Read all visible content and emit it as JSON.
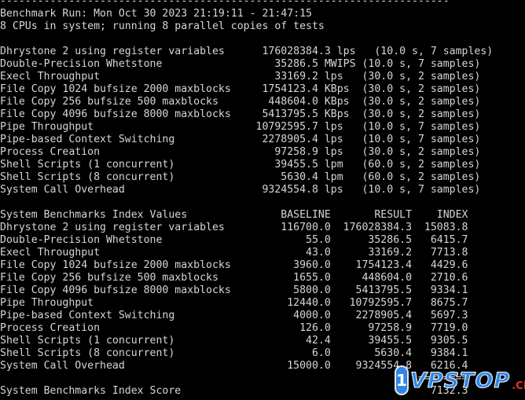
{
  "terminal": {
    "lines": [
      "------------------------------------------------------------------------",
      "Benchmark Run: Mon Oct 30 2023 21:19:11 - 21:47:15",
      "8 CPUs in system; running 8 parallel copies of tests",
      "",
      "Dhrystone 2 using register variables      176028384.3 lps   (10.0 s, 7 samples)",
      "Double-Precision Whetstone                  35286.5 MWIPS (10.0 s, 7 samples)",
      "Execl Throughput                            33169.2 lps   (30.0 s, 2 samples)",
      "File Copy 1024 bufsize 2000 maxblocks     1754123.4 KBps  (30.0 s, 2 samples)",
      "File Copy 256 bufsize 500 maxblocks        448604.0 KBps  (30.0 s, 2 samples)",
      "File Copy 4096 bufsize 8000 maxblocks     5413795.5 KBps  (30.0 s, 2 samples)",
      "Pipe Throughput                          10792595.7 lps   (10.0 s, 7 samples)",
      "Pipe-based Context Switching              2278905.4 lps   (10.0 s, 7 samples)",
      "Process Creation                            97258.9 lps   (30.0 s, 2 samples)",
      "Shell Scripts (1 concurrent)                39455.5 lpm   (60.0 s, 2 samples)",
      "Shell Scripts (8 concurrent)                 5630.4 lpm   (60.0 s, 2 samples)",
      "System Call Overhead                      9324554.8 lps   (10.0 s, 7 samples)",
      "",
      "System Benchmarks Index Values               BASELINE       RESULT    INDEX",
      "Dhrystone 2 using register variables         116700.0  176028384.3  15083.8",
      "Double-Precision Whetstone                       55.0      35286.5   6415.7",
      "Execl Throughput                                 43.0      33169.2   7713.8",
      "File Copy 1024 bufsize 2000 maxblocks          3960.0    1754123.4   4429.6",
      "File Copy 256 bufsize 500 maxblocks            1655.0     448604.0   2710.6",
      "File Copy 4096 bufsize 8000 maxblocks          5800.0    5413795.5   9334.1",
      "Pipe Throughput                               12440.0   10792595.7   8675.7",
      "Pipe-based Context Switching                   4000.0    2278905.4   5697.3",
      "Process Creation                                126.0      97258.9   7719.0",
      "Shell Scripts (1 concurrent)                     42.4      39455.5   9305.5",
      "Shell Scripts (8 concurrent)                      6.0       5630.4   9384.1",
      "System Call Overhead                          15000.0    9324554.8   6216.4",
      "                                                                   ========",
      "System Benchmarks Index Score                                        7132.3"
    ]
  },
  "watermark": {
    "badge": "1",
    "text": "VPSTOP",
    "suffix": ".CN",
    "color": "#2f86e6",
    "suffix_color": "#e8341f"
  }
}
